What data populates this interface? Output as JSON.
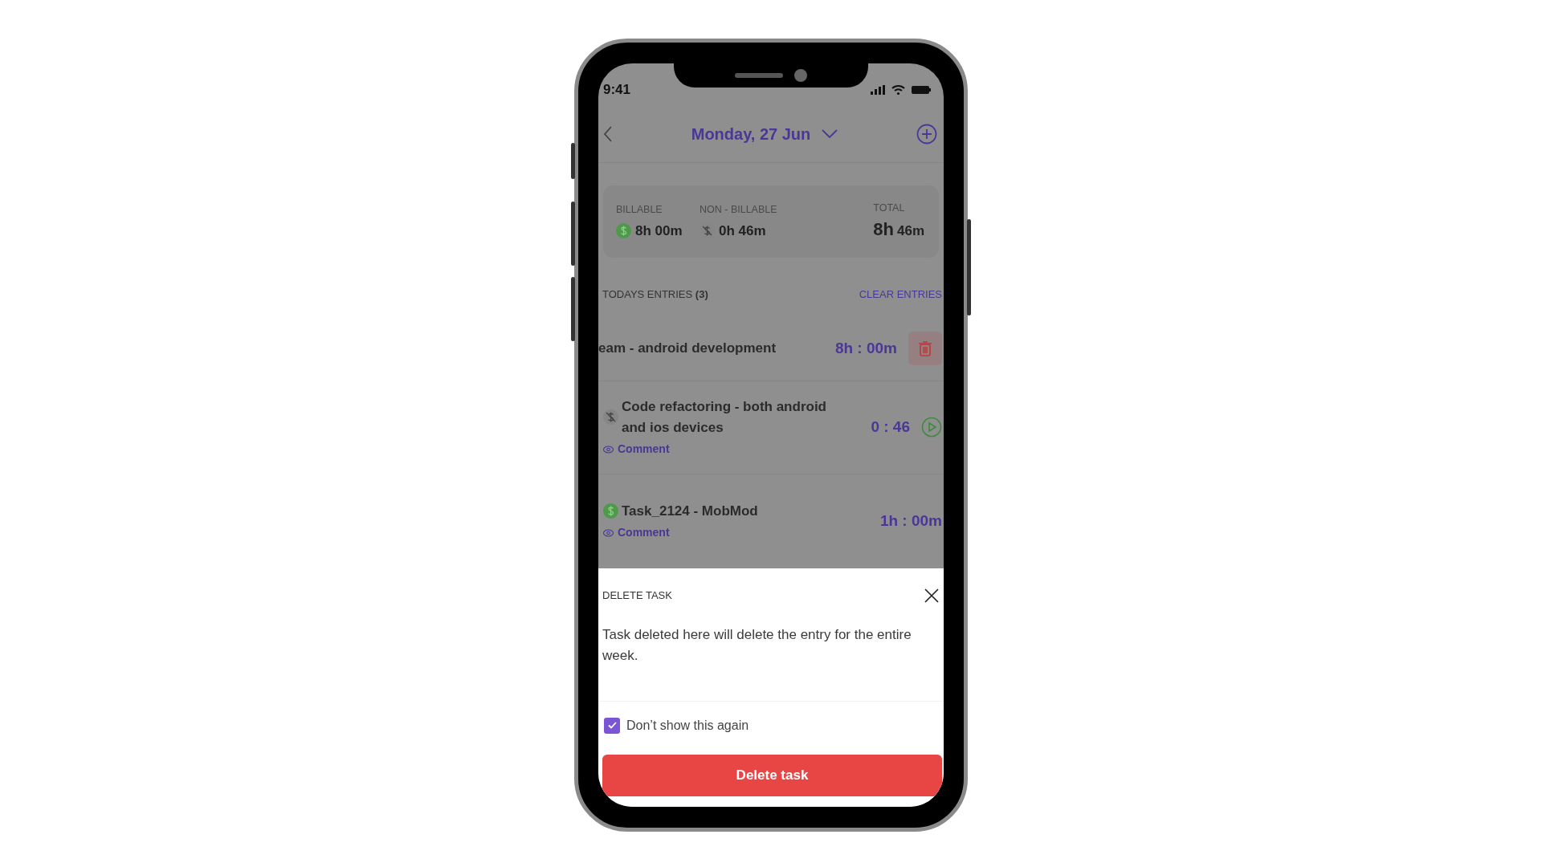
{
  "status_bar": {
    "time": "9:41"
  },
  "header": {
    "title": "Monday, 27 Jun"
  },
  "summary": [
    {
      "label": "BILLABLE",
      "value": "8h 00m",
      "billable": true
    },
    {
      "label": "NON - BILLABLE",
      "value": "0h 46m",
      "billable": false
    }
  ],
  "total": {
    "label": "TOTAL",
    "hours": "8h",
    "minutes": "46m"
  },
  "entries_header": {
    "title": "TODAYS ENTRIES **(3)**",
    "action": "CLEAR ENTRIES"
  },
  "entries": [
    {
      "kind": "swiped",
      "name": "eam - android development",
      "duration": "8h : 00m"
    },
    {
      "kind": "running",
      "name": "Code refactoring - both android and ios devices",
      "duration": "0 : 46",
      "billable": false,
      "comment": "Comment"
    },
    {
      "kind": "plain",
      "name": "Task_2124 - MobMod",
      "duration": "1h : 00m",
      "billable": true,
      "comment": "Comment"
    }
  ],
  "sheet": {
    "title": "DELETE TASK",
    "message": "Task deleted here will delete the entry for the entire week.",
    "checkbox": {
      "label": "Don’t show this again",
      "checked": true
    },
    "button": "Delete task"
  }
}
